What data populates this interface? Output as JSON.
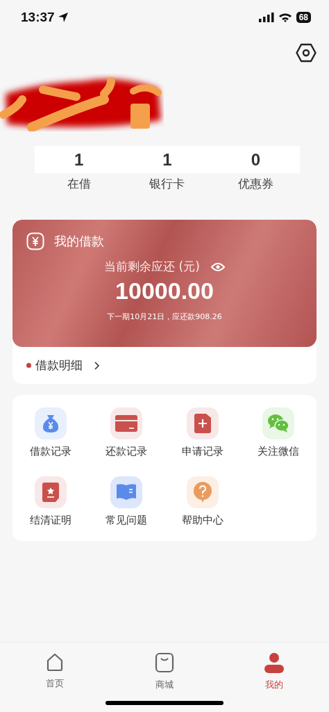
{
  "status_bar": {
    "time": "13:37",
    "battery": "68"
  },
  "stats": [
    {
      "value": "1",
      "label": "在借"
    },
    {
      "value": "1",
      "label": "银行卡"
    },
    {
      "value": "0",
      "label": "优惠券"
    }
  ],
  "loan_card": {
    "title": "我的借款",
    "amount_label": "当前剩余应还 (元)",
    "amount": "10000.00",
    "next_payment": "下一期10月21日，应还款908.26",
    "detail_link": "借款明细"
  },
  "services": [
    {
      "label": "借款记录"
    },
    {
      "label": "还款记录"
    },
    {
      "label": "申请记录"
    },
    {
      "label": "关注微信"
    },
    {
      "label": "结清证明"
    },
    {
      "label": "常见问题"
    },
    {
      "label": "帮助中心"
    }
  ],
  "tab_bar": [
    {
      "label": "首页",
      "selected": false
    },
    {
      "label": "商城",
      "selected": false
    },
    {
      "label": "我的",
      "selected": true
    }
  ]
}
